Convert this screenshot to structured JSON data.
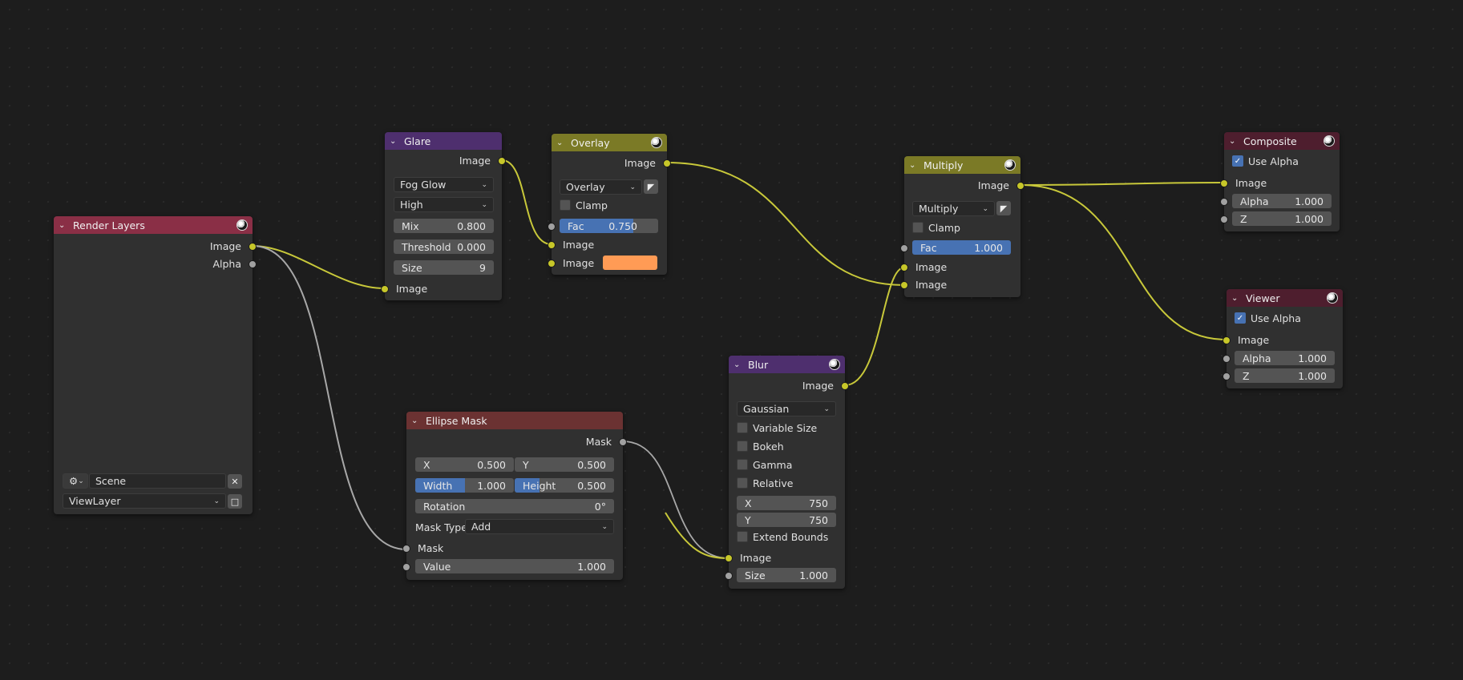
{
  "colors": {
    "socket_color": "#c7c729",
    "socket_value": "#a1a1a1",
    "link": "#c8c83a",
    "link_gray": "#a8a8a8",
    "header_input": "#8a2f46",
    "header_filter": "#4e2f6e",
    "header_color": "#7b7a26",
    "header_converter": "#6b3232",
    "header_output": "#4e1e2e",
    "overlay_swatch": "#ff9b55"
  },
  "render_layers": {
    "title": "Render Layers",
    "out_image": "Image",
    "out_alpha": "Alpha",
    "scene": "Scene",
    "view_layer": "ViewLayer"
  },
  "glare": {
    "title": "Glare",
    "out_image": "Image",
    "type": "Fog Glow",
    "quality": "High",
    "mix_label": "Mix",
    "mix_value": "0.800",
    "threshold_label": "Threshold",
    "threshold_value": "0.000",
    "size_label": "Size",
    "size_value": "9",
    "in_image": "Image"
  },
  "overlay": {
    "title": "Overlay",
    "out_image": "Image",
    "blend": "Overlay",
    "clamp": "Clamp",
    "fac_label": "Fac",
    "fac_value": "0.750",
    "fac_fill": 0.75,
    "in_image1": "Image",
    "in_image2": "Image"
  },
  "multiply": {
    "title": "Multiply",
    "out_image": "Image",
    "blend": "Multiply",
    "clamp": "Clamp",
    "fac_label": "Fac",
    "fac_value": "1.000",
    "in_image1": "Image",
    "in_image2": "Image"
  },
  "composite": {
    "title": "Composite",
    "use_alpha": "Use Alpha",
    "in_image": "Image",
    "alpha_label": "Alpha",
    "alpha_value": "1.000",
    "z_label": "Z",
    "z_value": "1.000"
  },
  "viewer": {
    "title": "Viewer",
    "use_alpha": "Use Alpha",
    "in_image": "Image",
    "alpha_label": "Alpha",
    "alpha_value": "1.000",
    "z_label": "Z",
    "z_value": "1.000"
  },
  "ellipse": {
    "title": "Ellipse Mask",
    "out_mask": "Mask",
    "x_label": "X",
    "x_value": "0.500",
    "y_label": "Y",
    "y_value": "0.500",
    "width_label": "Width",
    "width_value": "1.000",
    "height_label": "Height",
    "height_value": "0.500",
    "rotation_label": "Rotation",
    "rotation_value": "0°",
    "mask_type_label": "Mask Type:",
    "mask_type": "Add",
    "in_mask": "Mask",
    "value_label": "Value",
    "value_value": "1.000"
  },
  "blur": {
    "title": "Blur",
    "out_image": "Image",
    "filter": "Gaussian",
    "variable_size": "Variable Size",
    "bokeh": "Bokeh",
    "gamma": "Gamma",
    "relative": "Relative",
    "x_label": "X",
    "x_value": "750",
    "y_label": "Y",
    "y_value": "750",
    "extend_bounds": "Extend Bounds",
    "in_image": "Image",
    "size_label": "Size",
    "size_value": "1.000"
  }
}
